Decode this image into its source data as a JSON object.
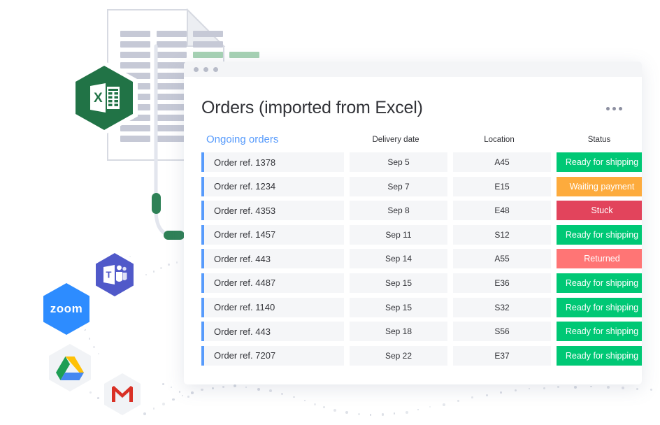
{
  "illustration": {
    "document_icon": "spreadsheet-document",
    "apps": [
      {
        "name": "excel-icon",
        "label": "X"
      },
      {
        "name": "microsoft-teams-icon",
        "label": "T"
      },
      {
        "name": "zoom-icon",
        "label": "zoom"
      },
      {
        "name": "google-drive-icon",
        "label": ""
      },
      {
        "name": "gmail-icon",
        "label": "M"
      }
    ]
  },
  "card": {
    "title": "Orders (imported from Excel)",
    "menu_icon": "kebab-menu-icon",
    "add_column_icon": "plus-icon",
    "group_title": "Ongoing orders",
    "columns": [
      "Delivery date",
      "Location",
      "Status"
    ],
    "accent_color": "#579bfc",
    "status_colors": {
      "Ready for shipping": "#00c875",
      "Waiting payment": "#fdab3d",
      "Stuck": "#e2445c",
      "Returned": "#ff7575"
    },
    "rows": [
      {
        "name": "Order ref. 1378",
        "date": "Sep 5",
        "location": "A45",
        "status": "Ready for shipping"
      },
      {
        "name": "Order ref. 1234",
        "date": "Sep 7",
        "location": "E15",
        "status": "Waiting payment"
      },
      {
        "name": "Order ref. 4353",
        "date": "Sep 8",
        "location": "E48",
        "status": "Stuck"
      },
      {
        "name": "Order ref. 1457",
        "date": "Sep 11",
        "location": "S12",
        "status": "Ready for shipping"
      },
      {
        "name": "Order ref. 443",
        "date": "Sep 14",
        "location": "A55",
        "status": "Returned"
      },
      {
        "name": "Order ref. 4487",
        "date": "Sep 15",
        "location": "E36",
        "status": "Ready for shipping"
      },
      {
        "name": "Order ref. 1140",
        "date": "Sep 15",
        "location": "S32",
        "status": "Ready for shipping"
      },
      {
        "name": "Order ref. 443",
        "date": "Sep 18",
        "location": "S56",
        "status": "Ready for shipping"
      },
      {
        "name": "Order ref. 7207",
        "date": "Sep 22",
        "location": "E37",
        "status": "Ready for shipping"
      }
    ]
  }
}
